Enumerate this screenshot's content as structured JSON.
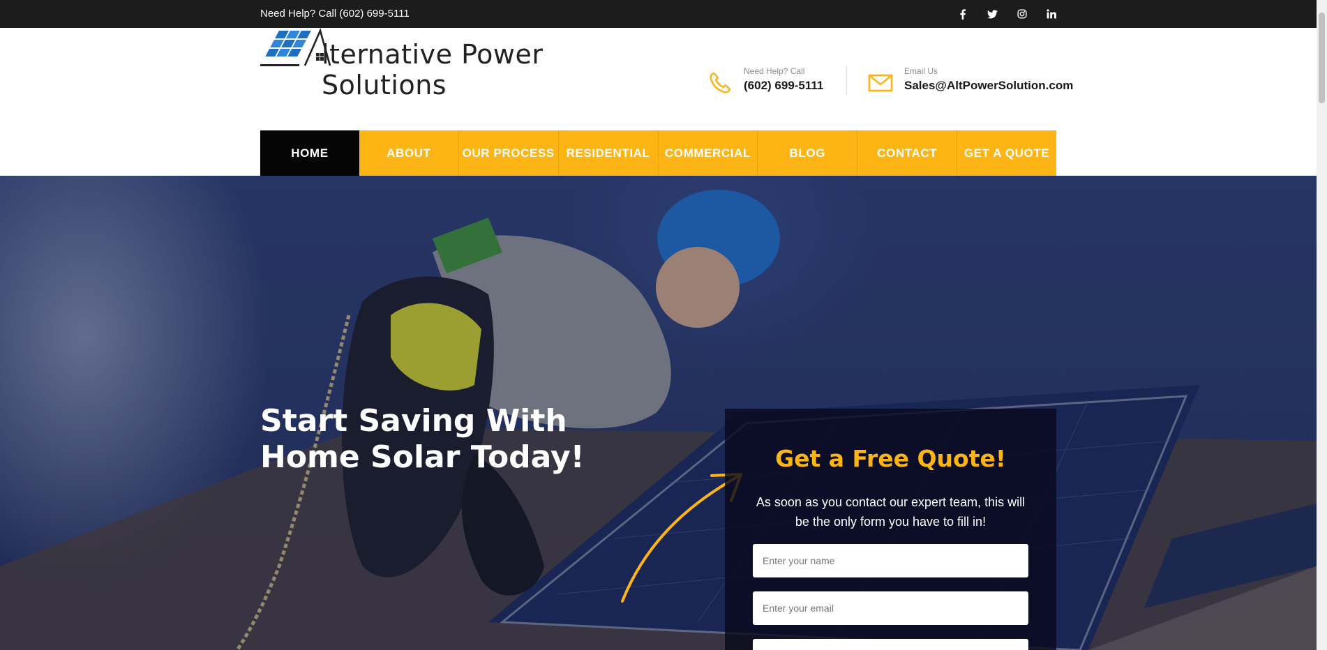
{
  "topbar": {
    "help_text": "Need Help? Call (602) 699-5111",
    "social": [
      {
        "icon": "facebook-icon",
        "glyph": "f"
      },
      {
        "icon": "twitter-icon",
        "glyph": "t"
      },
      {
        "icon": "instagram-icon",
        "glyph": "ig"
      },
      {
        "icon": "linkedin-icon",
        "glyph": "in"
      }
    ]
  },
  "header": {
    "logo_text": "lternative Power Solutions",
    "logo_letter": "A",
    "phone": {
      "label": "Need Help? Call",
      "value": "(602) 699-5111",
      "icon": "phone-icon"
    },
    "email": {
      "label": "Email Us",
      "value": "Sales@AltPowerSolution.com",
      "icon": "mail-icon"
    }
  },
  "nav": {
    "items": [
      "HOME",
      "ABOUT",
      "OUR PROCESS",
      "RESIDENTIAL",
      "COMMERCIAL",
      "BLOG",
      "CONTACT",
      "GET A QUOTE"
    ],
    "active_index": 0
  },
  "hero": {
    "title": "Start Saving With Home Solar Today!"
  },
  "quote": {
    "title": "Get a Free Quote!",
    "text": "As soon as you contact our expert team, this will be the only form you have to fill in!",
    "name_placeholder": "Enter your name",
    "email_placeholder": "Enter your email"
  },
  "colors": {
    "accent": "#fdb515",
    "topbar": "#1c1c1c",
    "nav_active": "#050505",
    "logo_blue": "#1e6fc0"
  }
}
